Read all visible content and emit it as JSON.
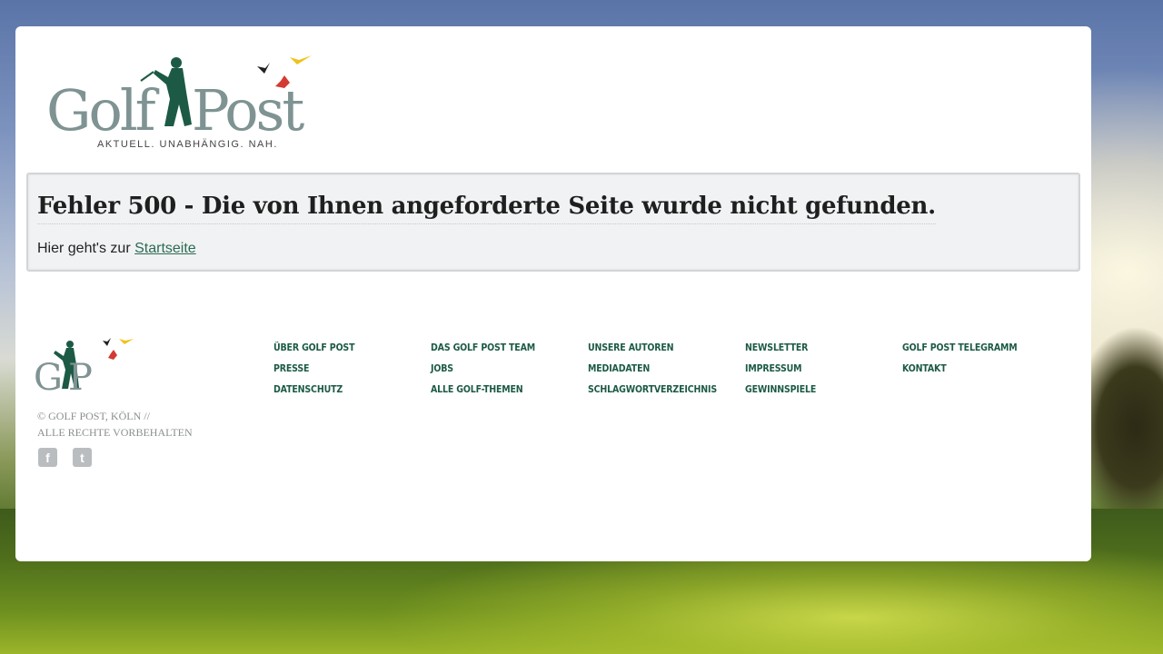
{
  "brand": {
    "name_part1": "Golf",
    "name_part2": "Post",
    "tagline": "AKTUELL. UNABHÄNGIG. NAH.",
    "colors": {
      "grey": "#7f9393",
      "green": "#1c5a46",
      "red": "#d23a32",
      "yellow": "#f0c21a",
      "black": "#222222"
    }
  },
  "error": {
    "title": "Fehler 500 - Die von Ihnen angeforderte Seite wurde nicht gefunden.",
    "text_prefix": "Hier geht's zur",
    "link_label": "Startseite"
  },
  "footer": {
    "logo_text": "GP",
    "copyright_line1": "© GOLF POST, KÖLN //",
    "copyright_line2": "ALLE RECHTE VORBEHALTEN",
    "social": [
      {
        "icon": "facebook-icon",
        "glyph": "f"
      },
      {
        "icon": "twitter-icon",
        "glyph": "t"
      }
    ],
    "links": [
      "ÜBER GOLF POST",
      "DAS GOLF POST TEAM",
      "UNSERE AUTOREN",
      "NEWSLETTER",
      "GOLF POST TELEGRAMM",
      "PRESSE",
      "JOBS",
      "MEDIADATEN",
      "IMPRESSUM",
      "KONTAKT",
      "DATENSCHUTZ",
      "ALLE GOLF-THEMEN",
      "SCHLAGWORTVERZEICHNIS",
      "GEWINNSPIELE"
    ]
  }
}
